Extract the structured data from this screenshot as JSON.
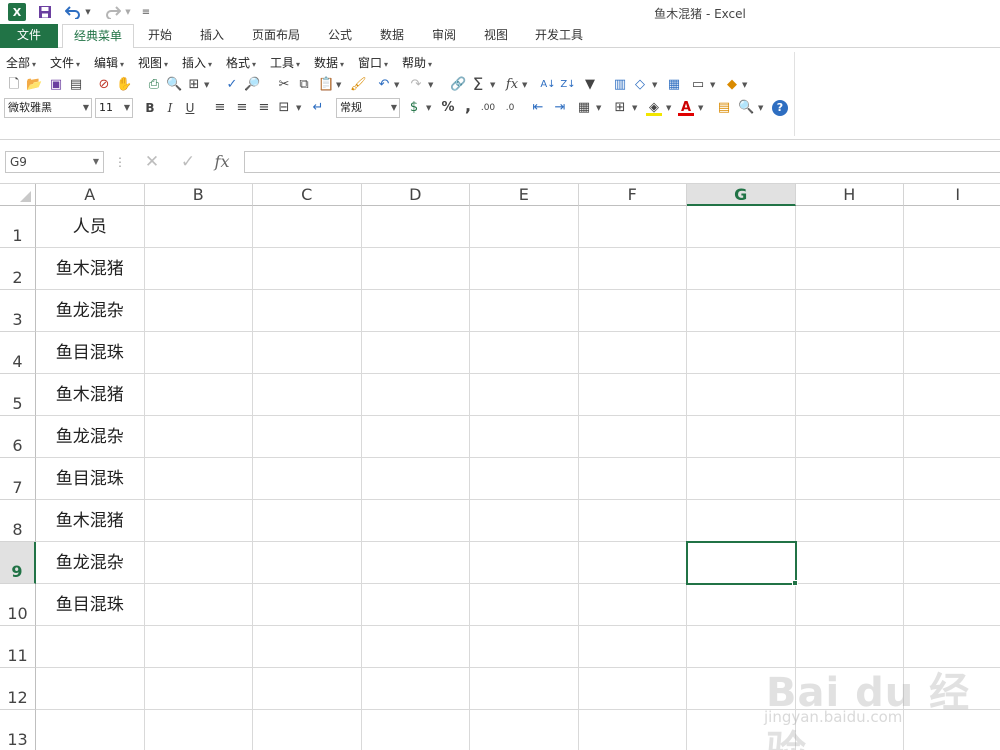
{
  "app": {
    "title": "鱼木混猪 - Excel"
  },
  "quick_access": {
    "logo_letter": "X",
    "save_icon": "save-icon",
    "undo_icon": "undo-icon",
    "redo_icon": "redo-icon",
    "customize_icon": "customize-icon"
  },
  "tabs": {
    "file": "文件",
    "items": [
      "经典菜单",
      "开始",
      "插入",
      "页面布局",
      "公式",
      "数据",
      "审阅",
      "视图",
      "开发工具"
    ]
  },
  "classic_menu": {
    "items": [
      "全部",
      "文件",
      "编辑",
      "视图",
      "插入",
      "格式",
      "工具",
      "数据",
      "窗口",
      "帮助"
    ]
  },
  "format_bar": {
    "font_name": "微软雅黑",
    "font_size": "11",
    "bold": "B",
    "italic": "I",
    "underline": "U",
    "number_format": "常规",
    "percent": "%",
    "comma": ","
  },
  "formula_bar": {
    "name_box": "G9",
    "fx": "fx",
    "formula": ""
  },
  "grid": {
    "columns": [
      "A",
      "B",
      "C",
      "D",
      "E",
      "F",
      "G",
      "H",
      "I"
    ],
    "rows": [
      "1",
      "2",
      "3",
      "4",
      "5",
      "6",
      "7",
      "8",
      "9",
      "10",
      "11",
      "12",
      "13"
    ],
    "selected_column": "G",
    "selected_row": "9",
    "column_a": [
      "人员",
      "鱼木混猪",
      "鱼龙混杂",
      "鱼目混珠",
      "鱼木混猪",
      "鱼龙混杂",
      "鱼目混珠",
      "鱼木混猪",
      "鱼龙混杂",
      "鱼目混珠",
      "",
      "",
      ""
    ]
  },
  "watermark": {
    "brand": "Bai du 经验",
    "url": "jingyan.baidu.com"
  },
  "colors": {
    "accent": "#217346",
    "gridline": "#d9d9d9"
  }
}
